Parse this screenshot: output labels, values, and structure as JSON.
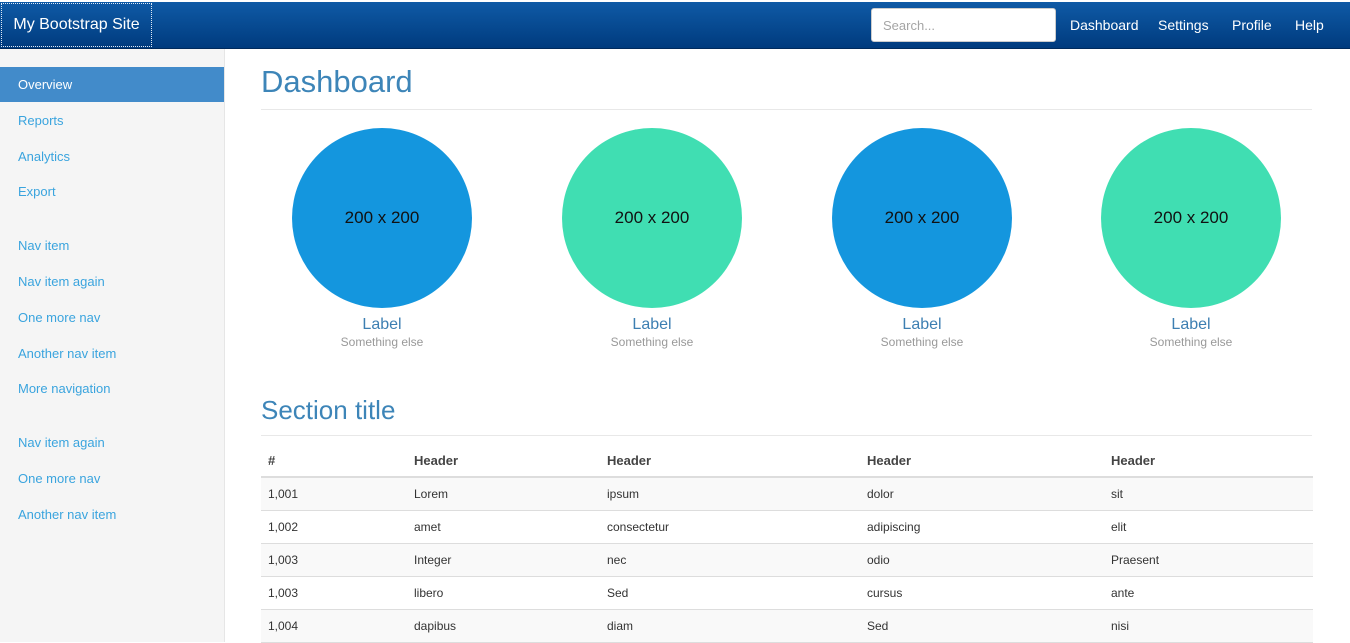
{
  "navbar": {
    "brand": "My Bootstrap Site",
    "search_placeholder": "Search...",
    "links": [
      "Dashboard",
      "Settings",
      "Profile",
      "Help"
    ]
  },
  "sidebar": {
    "groups": [
      [
        "Overview",
        "Reports",
        "Analytics",
        "Export"
      ],
      [
        "Nav item",
        "Nav item again",
        "One more nav",
        "Another nav item",
        "More navigation"
      ],
      [
        "Nav item again",
        "One more nav",
        "Another nav item"
      ]
    ],
    "active": "Overview"
  },
  "main": {
    "title": "Dashboard",
    "placeholders": [
      {
        "text": "200 x 200",
        "label": "Label",
        "sub": "Something else",
        "color": "#1496de"
      },
      {
        "text": "200 x 200",
        "label": "Label",
        "sub": "Something else",
        "color": "#40deb2"
      },
      {
        "text": "200 x 200",
        "label": "Label",
        "sub": "Something else",
        "color": "#1496de"
      },
      {
        "text": "200 x 200",
        "label": "Label",
        "sub": "Something else",
        "color": "#40deb2"
      }
    ],
    "section_title": "Section title",
    "table": {
      "headers": [
        "#",
        "Header",
        "Header",
        "Header",
        "Header"
      ],
      "rows": [
        [
          "1,001",
          "Lorem",
          "ipsum",
          "dolor",
          "sit"
        ],
        [
          "1,002",
          "amet",
          "consectetur",
          "adipiscing",
          "elit"
        ],
        [
          "1,003",
          "Integer",
          "nec",
          "odio",
          "Praesent"
        ],
        [
          "1,003",
          "libero",
          "Sed",
          "cursus",
          "ante"
        ],
        [
          "1,004",
          "dapibus",
          "diam",
          "Sed",
          "nisi"
        ]
      ]
    }
  },
  "colors": {
    "navbar_top": "#0f5aa6",
    "navbar_bottom": "#003b7e",
    "active_nav": "#428bca",
    "link": "#3aa4de",
    "heading": "#3d85b8"
  }
}
